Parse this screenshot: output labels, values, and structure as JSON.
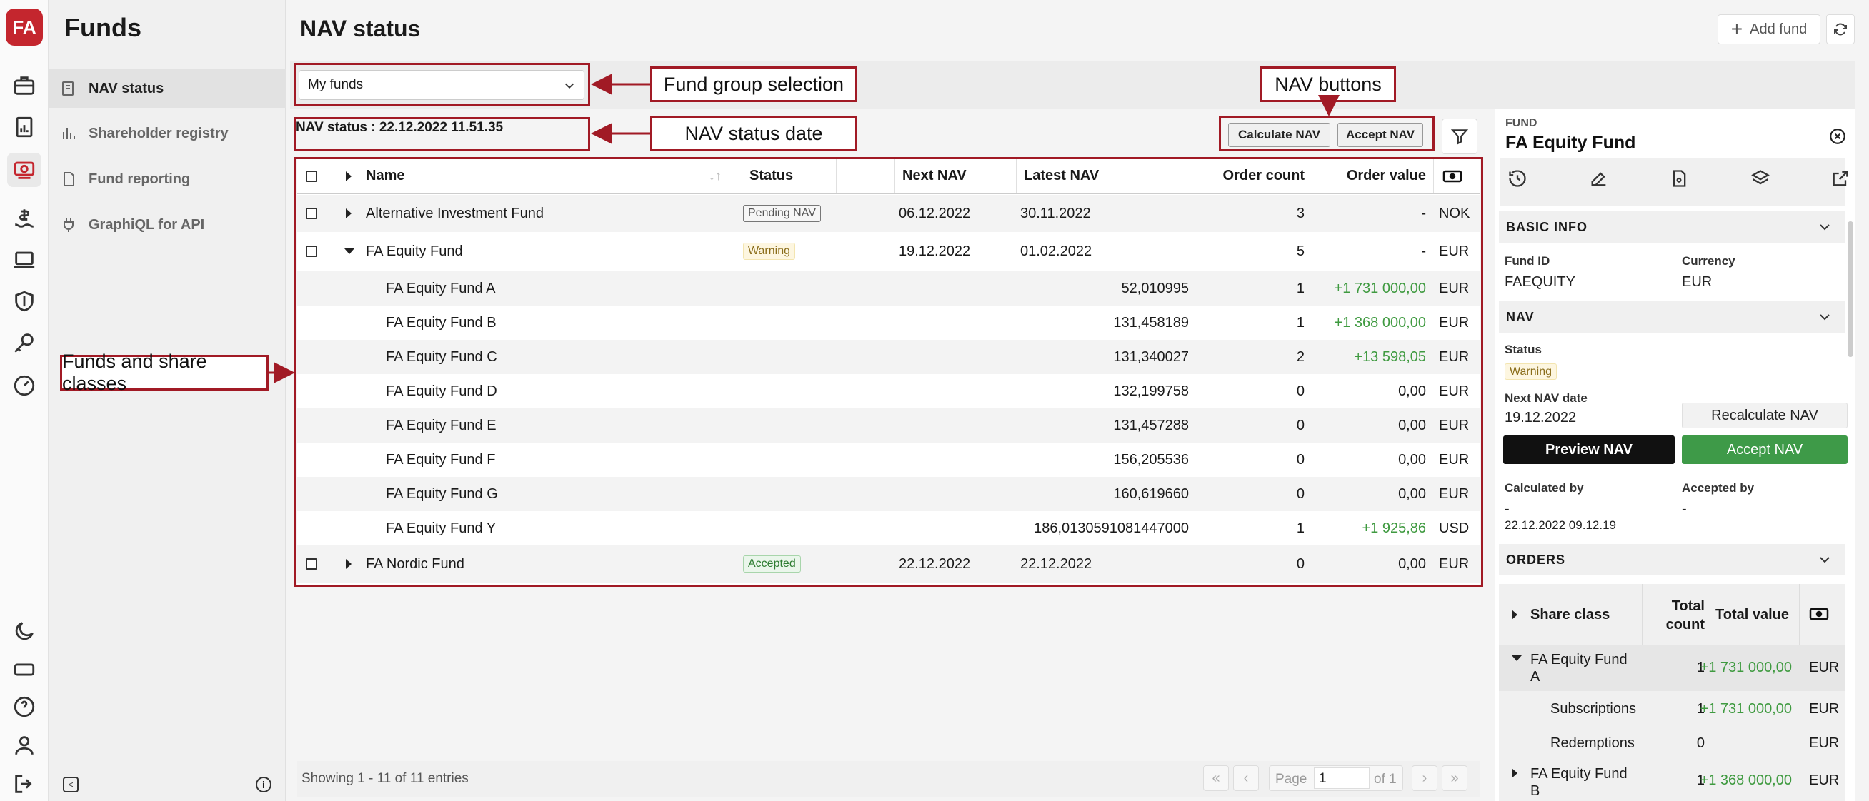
{
  "app": {
    "title": "Funds",
    "logo": "FA"
  },
  "rail": {
    "icons": [
      "briefcase-icon",
      "reports-icon",
      "funds-icon",
      "money-icon",
      "laptop-icon",
      "shield-icon",
      "key-icon",
      "gauge-icon",
      "moon-icon",
      "ticket-icon",
      "help-icon",
      "user-icon",
      "logout-icon"
    ]
  },
  "sidebar": {
    "items": [
      {
        "label": "NAV status",
        "icon": "nav-icon"
      },
      {
        "label": "Shareholder registry",
        "icon": "chart-icon"
      },
      {
        "label": "Fund reporting",
        "icon": "file-icon"
      },
      {
        "label": "GraphiQL for API",
        "icon": "plug-icon"
      }
    ]
  },
  "page": {
    "title": "NAV status",
    "add_fund": "Add fund"
  },
  "fund_group": {
    "value": "My funds"
  },
  "annotations": {
    "fund_group": "Fund group selection",
    "nav_buttons": "NAV buttons",
    "nav_date": "NAV status date",
    "funds": "Funds and share classes"
  },
  "nav_status_date": "NAV status : 22.12.2022 11.51.35",
  "buttons": {
    "calculate": "Calculate NAV",
    "accept": "Accept NAV"
  },
  "table": {
    "columns": {
      "name": "Name",
      "status": "Status",
      "next_nav": "Next NAV",
      "latest_nav": "Latest NAV",
      "order_count": "Order count",
      "order_value": "Order value"
    },
    "rows": [
      {
        "name": "Alternative Investment Fund",
        "status": "Pending NAV",
        "next": "06.12.2022",
        "latest": "30.11.2022",
        "count": "3",
        "value": "-",
        "cur": "NOK"
      },
      {
        "name": "FA Equity Fund",
        "status": "Warning",
        "next": "19.12.2022",
        "latest": "01.02.2022",
        "count": "5",
        "value": "-",
        "cur": "EUR"
      },
      {
        "name": "FA Equity Fund A",
        "latest": "52,010995",
        "count": "1",
        "value": "+1 731 000,00",
        "cur": "EUR"
      },
      {
        "name": "FA Equity Fund B",
        "latest": "131,458189",
        "count": "1",
        "value": "+1 368 000,00",
        "cur": "EUR"
      },
      {
        "name": "FA Equity Fund C",
        "latest": "131,340027",
        "count": "2",
        "value": "+13 598,05",
        "cur": "EUR"
      },
      {
        "name": "FA Equity Fund D",
        "latest": "132,199758",
        "count": "0",
        "value": "0,00",
        "cur": "EUR"
      },
      {
        "name": "FA Equity Fund E",
        "latest": "131,457288",
        "count": "0",
        "value": "0,00",
        "cur": "EUR"
      },
      {
        "name": "FA Equity Fund F",
        "latest": "156,205536",
        "count": "0",
        "value": "0,00",
        "cur": "EUR"
      },
      {
        "name": "FA Equity Fund G",
        "latest": "160,619660",
        "count": "0",
        "value": "0,00",
        "cur": "EUR"
      },
      {
        "name": "FA Equity Fund Y",
        "latest": "186,0130591081447000",
        "count": "1",
        "value": "+1 925,86",
        "cur": "USD"
      },
      {
        "name": "FA Nordic Fund",
        "status": "Accepted",
        "next": "22.12.2022",
        "latest": "22.12.2022",
        "count": "0",
        "value": "0,00",
        "cur": "EUR"
      }
    ]
  },
  "footer": {
    "info": "Showing 1 - 11 of 11 entries",
    "page_label": "Page",
    "page": "1",
    "of": "of 1"
  },
  "panel": {
    "caption": "FUND",
    "title": "FA Equity Fund",
    "basic_info": "BASIC INFO",
    "fund_id_label": "Fund ID",
    "fund_id": "FAEQUITY",
    "currency_label": "Currency",
    "currency": "EUR",
    "nav_section": "NAV",
    "status_label": "Status",
    "status": "Warning",
    "next_nav_label": "Next NAV date",
    "next_nav": "19.12.2022",
    "recalculate": "Recalculate NAV",
    "preview": "Preview NAV",
    "accept": "Accept NAV",
    "calc_by_label": "Calculated by",
    "calc_by": "-",
    "calc_time": "22.12.2022 09.12.19",
    "acc_by_label": "Accepted by",
    "acc_by": "-",
    "orders": "ORDERS",
    "orders_cols": {
      "share_class": "Share class",
      "total_count": "Total count",
      "total_value": "Total value"
    },
    "orders_rows": [
      {
        "name": "FA Equity Fund A",
        "count": "1",
        "value": "+1 731 000,00",
        "cur": "EUR"
      },
      {
        "name": "Subscriptions",
        "count": "1",
        "value": "+1 731 000,00",
        "cur": "EUR"
      },
      {
        "name": "Redemptions",
        "count": "0",
        "value": "",
        "cur": "EUR"
      },
      {
        "name": "FA Equity Fund B",
        "count": "1",
        "value": "+1 368 000,00",
        "cur": "EUR"
      }
    ]
  },
  "colors": {
    "brand": "#c4262e",
    "annotation": "#a11a25",
    "positive": "#3f9a40",
    "accept": "#3e9a48"
  }
}
